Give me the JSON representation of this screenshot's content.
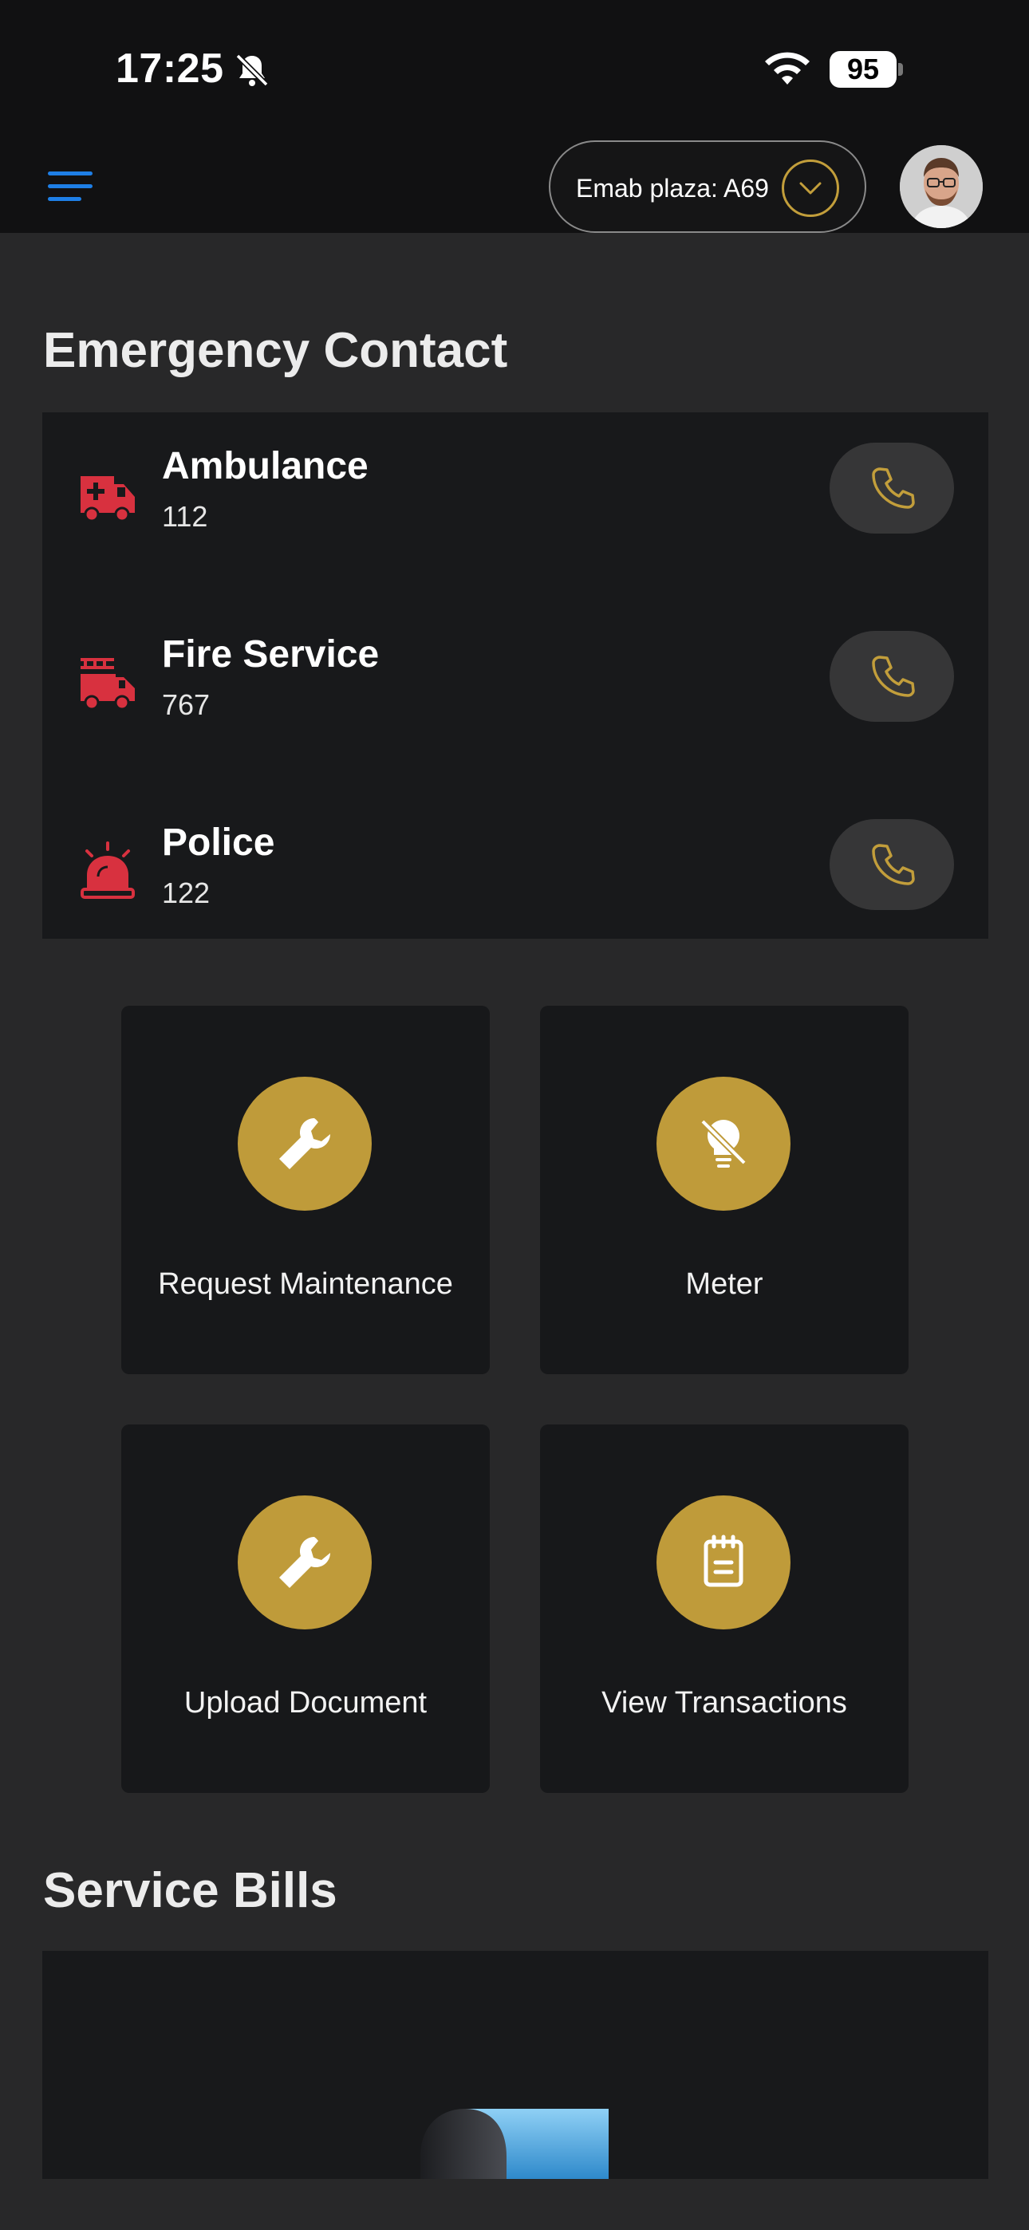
{
  "status_bar": {
    "time": "17:25",
    "battery": "95"
  },
  "header": {
    "location_label": "Emab plaza: A69"
  },
  "emergency": {
    "title": "Emergency Contact",
    "contacts": [
      {
        "name": "Ambulance",
        "number": "112",
        "icon": "ambulance-icon"
      },
      {
        "name": "Fire Service",
        "number": "767",
        "icon": "fire-truck-icon"
      },
      {
        "name": "Police",
        "number": "122",
        "icon": "siren-icon"
      }
    ]
  },
  "tiles": [
    {
      "label": "Request Maintenance",
      "icon": "wrench-icon"
    },
    {
      "label": "Meter",
      "icon": "bulb-off-icon"
    },
    {
      "label": "Upload Document",
      "icon": "wrench-icon"
    },
    {
      "label": "View Transactions",
      "icon": "notepad-icon"
    }
  ],
  "bills": {
    "title": "Service Bills"
  },
  "colors": {
    "accent_gold": "#bf9b3a",
    "emergency_red": "#d8313f",
    "menu_blue": "#1e7fe6",
    "background": "#282829",
    "card": "#18191b"
  }
}
